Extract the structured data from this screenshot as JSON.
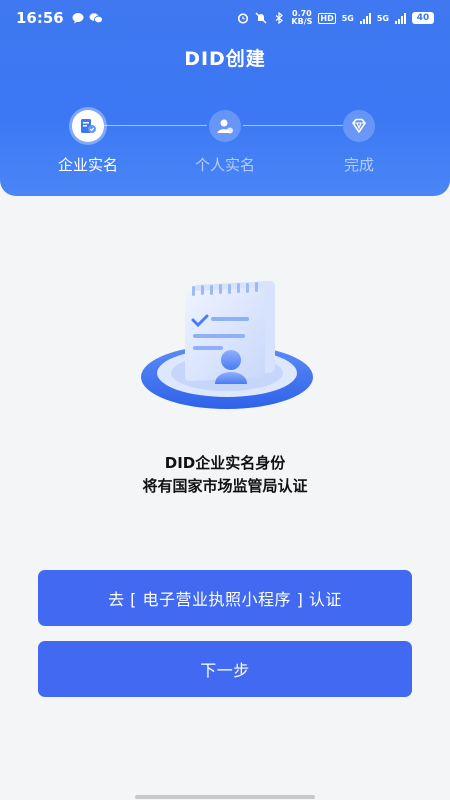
{
  "status_bar": {
    "time": "16:56",
    "net_speed_value": "0.70",
    "net_speed_unit": "KB/S",
    "network_a": "5G",
    "network_b": "5G",
    "battery": "40",
    "hd_label": "HD"
  },
  "header": {
    "title": "DID创建"
  },
  "steps": [
    {
      "label": "企业实名",
      "active": true,
      "icon": "enterprise-icon"
    },
    {
      "label": "个人实名",
      "active": false,
      "icon": "person-verify-icon"
    },
    {
      "label": "完成",
      "active": false,
      "icon": "diamond-icon"
    }
  ],
  "description": {
    "line1": "DID企业实名身份",
    "line2": "将有国家市场监管局认证"
  },
  "buttons": {
    "verify_label": "去 [ 电子营业执照小程序 ] 认证",
    "next_label": "下一步"
  },
  "colors": {
    "header_blue": "#3c78f4",
    "button_blue": "#4169f2",
    "background": "#f4f5f7"
  }
}
